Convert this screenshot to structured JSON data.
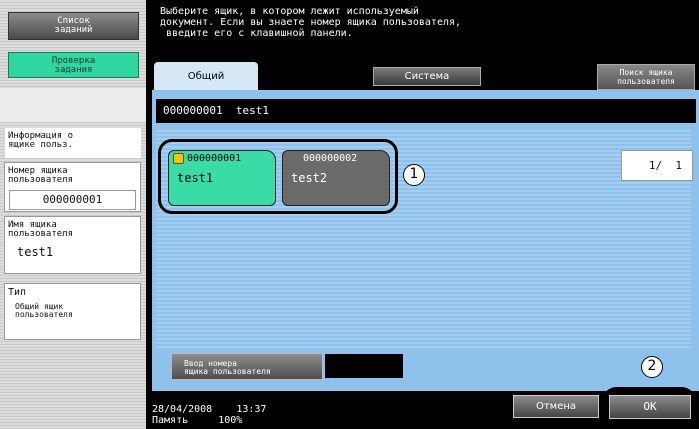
{
  "sidebar": {
    "job_list_label": "Список\nзаданий",
    "job_check_label": "Проверка\nзадания",
    "info_header": "Информация о\nящике польз.",
    "box_number_label": "Номер ящика\nпользователя",
    "box_number_value": "000000001",
    "box_name_label": "Имя ящика\nпользователя",
    "box_name_value": "test1",
    "type_label": "Тип",
    "type_value": "Общий ящик\nпользователя"
  },
  "message": "Выберите ящик, в котором лежит используемый\nдокумент. Если вы знаете номер ящика пользователя,\n введите его с клавишной панели.",
  "tabs": {
    "general": "Общий",
    "system": "Система",
    "search": "Поиск ящика\nпользователя"
  },
  "selected_box": "000000001  test1",
  "boxes": [
    {
      "number": "000000001",
      "name": "test1",
      "locked": true
    },
    {
      "number": "000000002",
      "name": "test2",
      "locked": false
    }
  ],
  "callouts": {
    "one": "1",
    "two": "2"
  },
  "pager": "1/  1",
  "input_box_number_label": "Ввод номера\nящика пользователя",
  "status": {
    "date": "28/04/2008",
    "time": "13:37",
    "memory_label": "Память",
    "memory_value": "100%"
  },
  "buttons": {
    "cancel": "Отмена",
    "ok": "OK"
  }
}
